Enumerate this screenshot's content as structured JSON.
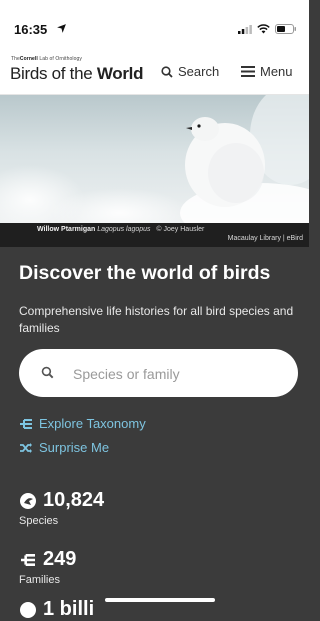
{
  "status_bar": {
    "time": "16:35"
  },
  "header": {
    "logo_small_prefix": "The",
    "logo_small_bold": "Cornell",
    "logo_small_suffix": " Lab of Ornithology",
    "logo_main_light": "Birds of the ",
    "logo_main_bold": "World",
    "search_label": "Search",
    "menu_label": "Menu"
  },
  "hero": {
    "caption_common_name": "Willow Ptarmigan",
    "caption_latin_name": "Lagopus lagopus",
    "caption_credit": "© Joey Hausler",
    "caption_library": "Macaulay Library  |  eBird"
  },
  "main": {
    "title": "Discover the world of birds",
    "subtitle": "Comprehensive life histories for all bird species and families",
    "search_placeholder": "Species or family",
    "links": [
      {
        "label": "Explore Taxonomy",
        "icon": "taxonomy-icon"
      },
      {
        "label": "Surprise Me",
        "icon": "shuffle-icon"
      }
    ],
    "stats": [
      {
        "value": "10,824",
        "label": "Species",
        "icon": "bird-icon"
      },
      {
        "value": "249",
        "label": "Families",
        "icon": "taxonomy-icon"
      }
    ],
    "partial_stat": "1 billi"
  },
  "colors": {
    "background": "#3b3b3b",
    "accent_link": "#7ec4e0",
    "header_bg": "#ffffff",
    "caption_bg": "#1f1f1f"
  }
}
